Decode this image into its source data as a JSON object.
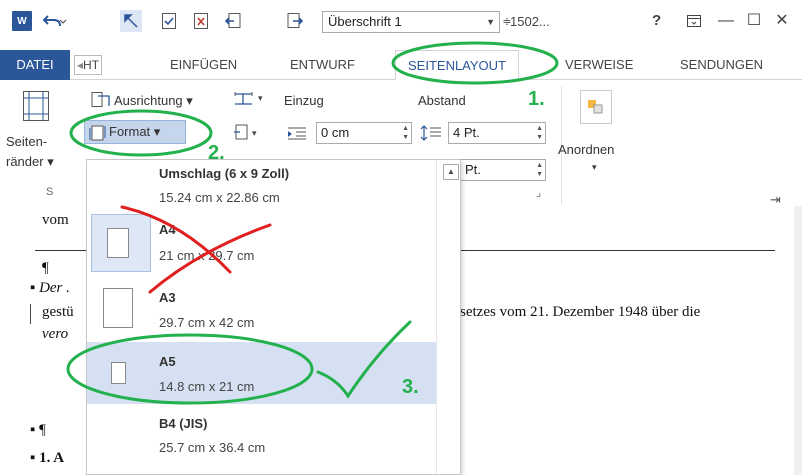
{
  "titlebar": {
    "app_icon": "W",
    "style_value": "Überschrift 1",
    "number_field": "1502...",
    "help": "?",
    "minimize": "—",
    "maximize": "☐",
    "close": "✕"
  },
  "tabs": {
    "file": "DATEI",
    "scrolled": "HT",
    "insert": "EINFÜGEN",
    "design": "ENTWURF",
    "layout": "SEITENLAYOUT",
    "references": "VERWEISE",
    "mailings": "SENDUNGEN"
  },
  "ribbon": {
    "margins_label_1": "Seiten-",
    "margins_label_2": "ränder ▾",
    "orientation": "Ausrichtung ▾",
    "format": "Format ▾",
    "indent_title": "Einzug",
    "spacing_title": "Abstand",
    "indent_value": "0 cm",
    "spacing_value": "4 Pt.",
    "spacing_value_2": "Pt.",
    "arrange": "Anordnen",
    "arrange_arrow": "▾",
    "group_letter": "S",
    "launcher": "⌟",
    "pin": "⇥"
  },
  "document": {
    "line_top": "vom",
    "pilcrow_1": "¶",
    "bullet_line": "▪ Der .",
    "line_gestu": "gestü",
    "line_gesetz": "setzes vom 21. Dezember 1948 über die",
    "line_vero": "vero",
    "pilcrow_2": "▪ ¶",
    "heading": "▪ 1. A"
  },
  "dropdown": {
    "items": [
      {
        "name": "Umschlag (6 x 9 Zoll)",
        "size": "15.24  cm x 22.86  cm"
      },
      {
        "name": "A4",
        "size": "21  cm x 29.7  cm"
      },
      {
        "name": "A3",
        "size": "29.7  cm x 42  cm"
      },
      {
        "name": "A5",
        "size": "14.8  cm x 21  cm"
      },
      {
        "name": "B4 (JIS)",
        "size": "25.7  cm x 36.4  cm"
      }
    ],
    "scroll_up": "▲"
  },
  "annotations": {
    "step1": "1.",
    "step2": "2.",
    "step3": "3."
  },
  "colors": {
    "accent": "#2b579a",
    "annotation_green": "#22b14c",
    "annotation_red": "#e02020",
    "hover_blue": "#d5e1f2"
  }
}
